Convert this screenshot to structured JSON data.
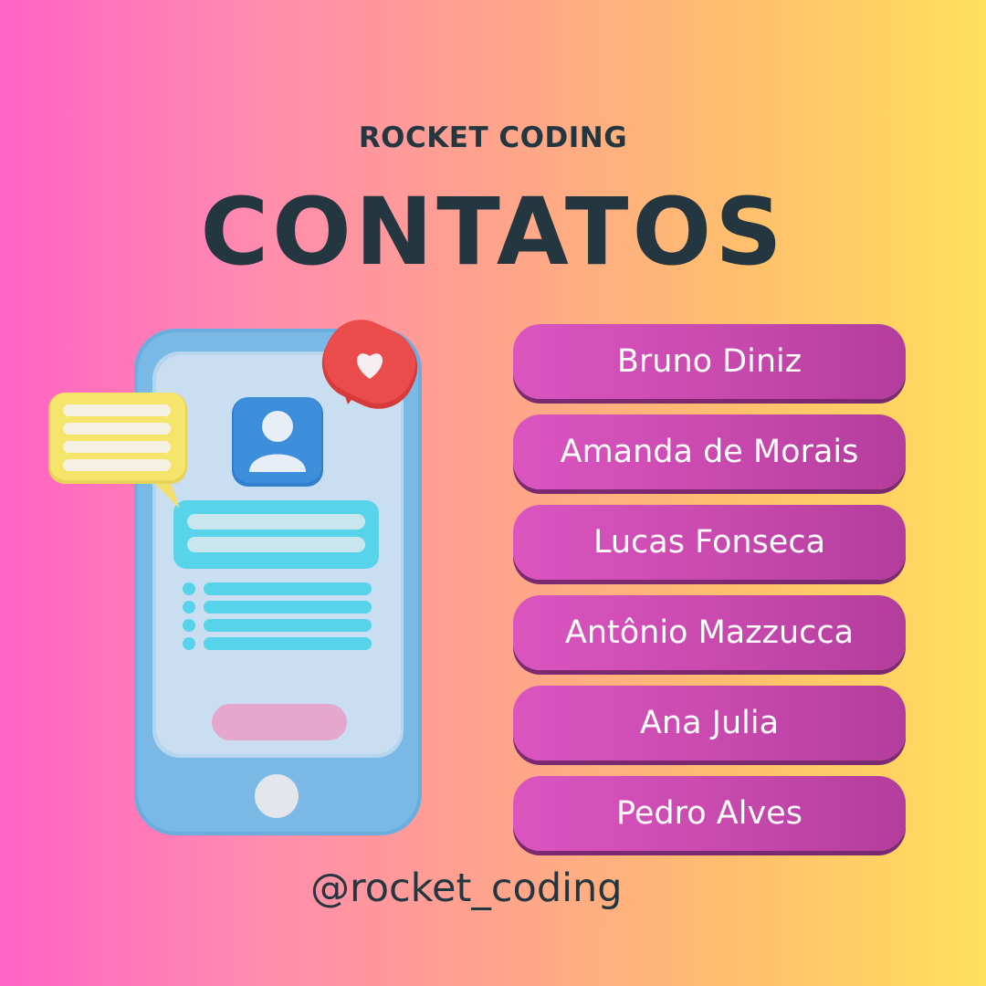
{
  "header": {
    "brand": "ROCKET CODING",
    "title": "CONTATOS"
  },
  "contacts": [
    {
      "name": "Bruno Diniz"
    },
    {
      "name": "Amanda de Morais"
    },
    {
      "name": "Lucas Fonseca"
    },
    {
      "name": "Antônio Mazzucca"
    },
    {
      "name": "Ana Julia"
    },
    {
      "name": "Pedro Alves"
    }
  ],
  "footer": {
    "handle": "@rocket_coding"
  },
  "illustration": {
    "icons": [
      "smartphone-icon",
      "chat-bubble-icon",
      "heart-bubble-icon",
      "user-avatar-icon"
    ]
  },
  "colors": {
    "text_dark": "#243640",
    "pill": "#c849ae",
    "pill_shadow": "#7b2a72",
    "phone_blue": "#6aaee0",
    "chat_yellow": "#f5e56a",
    "heart_red": "#ea4b4b",
    "avatar_blue": "#3d8fdc",
    "accent_cyan": "#57d3ea",
    "button_pink": "#e6a7cf"
  }
}
